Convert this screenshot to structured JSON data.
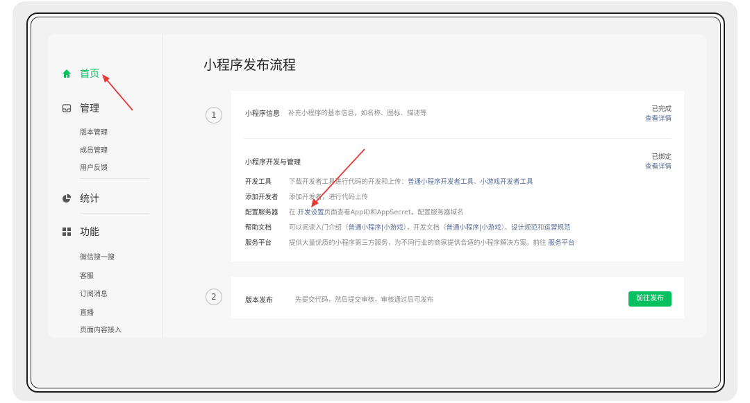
{
  "sidebar": {
    "home": "首页",
    "manage": {
      "label": "管理",
      "items": [
        "版本管理",
        "成员管理",
        "用户反馈"
      ]
    },
    "stats": "统计",
    "features": {
      "label": "功能",
      "items": [
        "微信搜一搜",
        "客服",
        "订阅消息",
        "直播",
        "页面内容接入"
      ]
    }
  },
  "main": {
    "title": "小程序发布流程",
    "step1": {
      "number": "1",
      "info": {
        "title": "小程序信息",
        "desc": "补充小程序的基本信息，如名称、图标、描述等",
        "status": "已完成",
        "link": "查看详情"
      },
      "dev": {
        "title": "小程序开发与管理",
        "status": "已绑定",
        "link": "查看详情",
        "rows": [
          {
            "label": "开发工具",
            "pre": "下载开发者工具进行代码的开发和上传：",
            "links": [
              "普通小程序开发者工具",
              "小游戏开发者工具"
            ],
            "sep": "、"
          },
          {
            "label": "添加开发者",
            "pre": "添加开发者，进行代码上传"
          },
          {
            "label": "配置服务器",
            "pre": "在",
            "link": "开发设置",
            "post": "页面查看AppID和AppSecret，配置服务器域名"
          },
          {
            "label": "帮助文档",
            "t1": "可以阅读入门介绍（",
            "l1": "普通小程序",
            "bar1": "|",
            "l2": "小游戏",
            "t2": "），开发文档（",
            "l3": "普通小程序",
            "bar2": "|",
            "l4": "小游戏",
            "t3": "）、",
            "l5": "设计规范",
            "t4": "和",
            "l6": "运营规范"
          },
          {
            "label": "服务平台",
            "pre": "提供大量优质的小程序第三方服务，为不同行业的商家提供合适的小程序解决方案。前往",
            "link": "服务平台"
          }
        ]
      }
    },
    "step2": {
      "number": "2",
      "title": "版本发布",
      "desc": "先提交代码，然后提交审核，审核通过后可发布",
      "button": "前往发布"
    }
  },
  "colors": {
    "accent": "#07c160",
    "link": "#576b95",
    "annotation": "#e53935"
  }
}
